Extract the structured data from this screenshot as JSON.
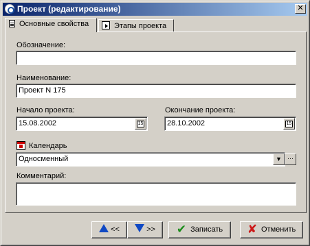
{
  "window": {
    "title": "Проект (редактирование)",
    "close_glyph": "✕",
    "icon": "app-logo-icon"
  },
  "tabs": [
    {
      "label": "Основные свойства",
      "icon": "document-icon",
      "active": true
    },
    {
      "label": "Этапы проекта",
      "icon": "stages-icon",
      "active": false
    }
  ],
  "form": {
    "designation_label": "Обозначение:",
    "designation_value": "",
    "name_label": "Наименование:",
    "name_value": "Проект N 175",
    "start_label": "Начало проекта:",
    "start_value": "15.08.2002",
    "end_label": "Окончание проекта:",
    "end_value": "28.10.2002",
    "date_button_glyph": "15",
    "calendar_label": "Календарь",
    "calendar_value": "Односменный",
    "calendar_dropdown_glyph": "▼",
    "calendar_more_glyph": "···",
    "comment_label": "Комментарий:",
    "comment_value": ""
  },
  "buttons": {
    "prev_label": "<<",
    "next_label": ">>",
    "save_label": "Записать",
    "cancel_label": "Отменить",
    "save_glyph": "✔",
    "cancel_glyph": "✘"
  },
  "colors": {
    "titlebar_start": "#0a246a",
    "titlebar_end": "#a6caf0",
    "face": "#d4d0c8",
    "arrow_blue": "#1049c4",
    "save_green": "#1a8c1a",
    "cancel_red": "#cc1a1a"
  }
}
